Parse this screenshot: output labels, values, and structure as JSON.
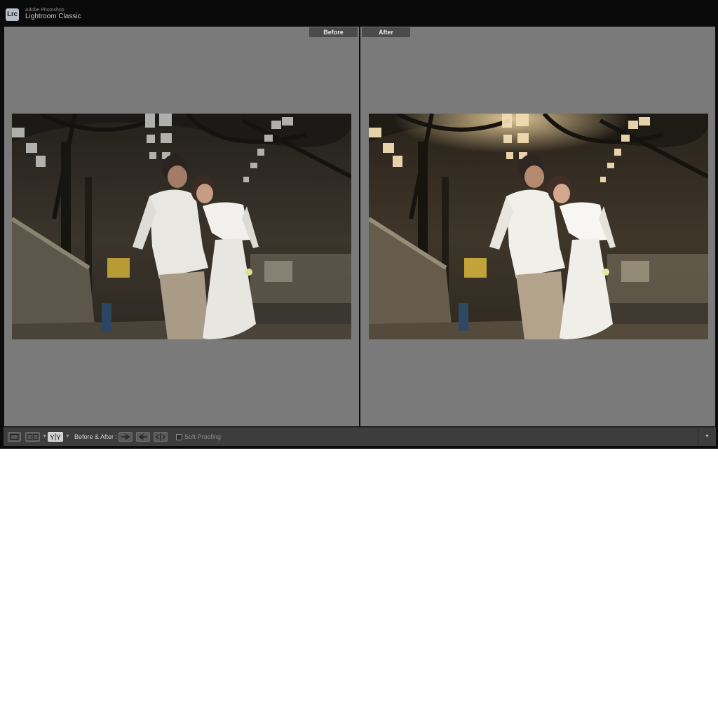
{
  "app": {
    "logo_text": "Lrc",
    "brand_top": "Adobe Photoshop",
    "brand_main": "Lightroom Classic"
  },
  "viewer": {
    "before_label": "Before",
    "after_label": "After"
  },
  "toolbar": {
    "before_after_label": "Before & After :",
    "soft_proofing_label": "Soft Proofing",
    "soft_proofing_checked": false
  },
  "colors": {
    "pane_background": "#7a7a7a",
    "toolbar_background": "#3d3d3d",
    "label_background": "#4b4b4b"
  },
  "icons": {
    "loupe_view": "single-rect-icon",
    "compare_view": "two-rects-icon",
    "before_after_view": "yy-split-icon",
    "copy_before_to_after": "arrow-right-icon",
    "copy_after_to_before": "arrow-left-icon",
    "swap": "swap-icon",
    "panel_menu": "triangle-down-icon"
  }
}
